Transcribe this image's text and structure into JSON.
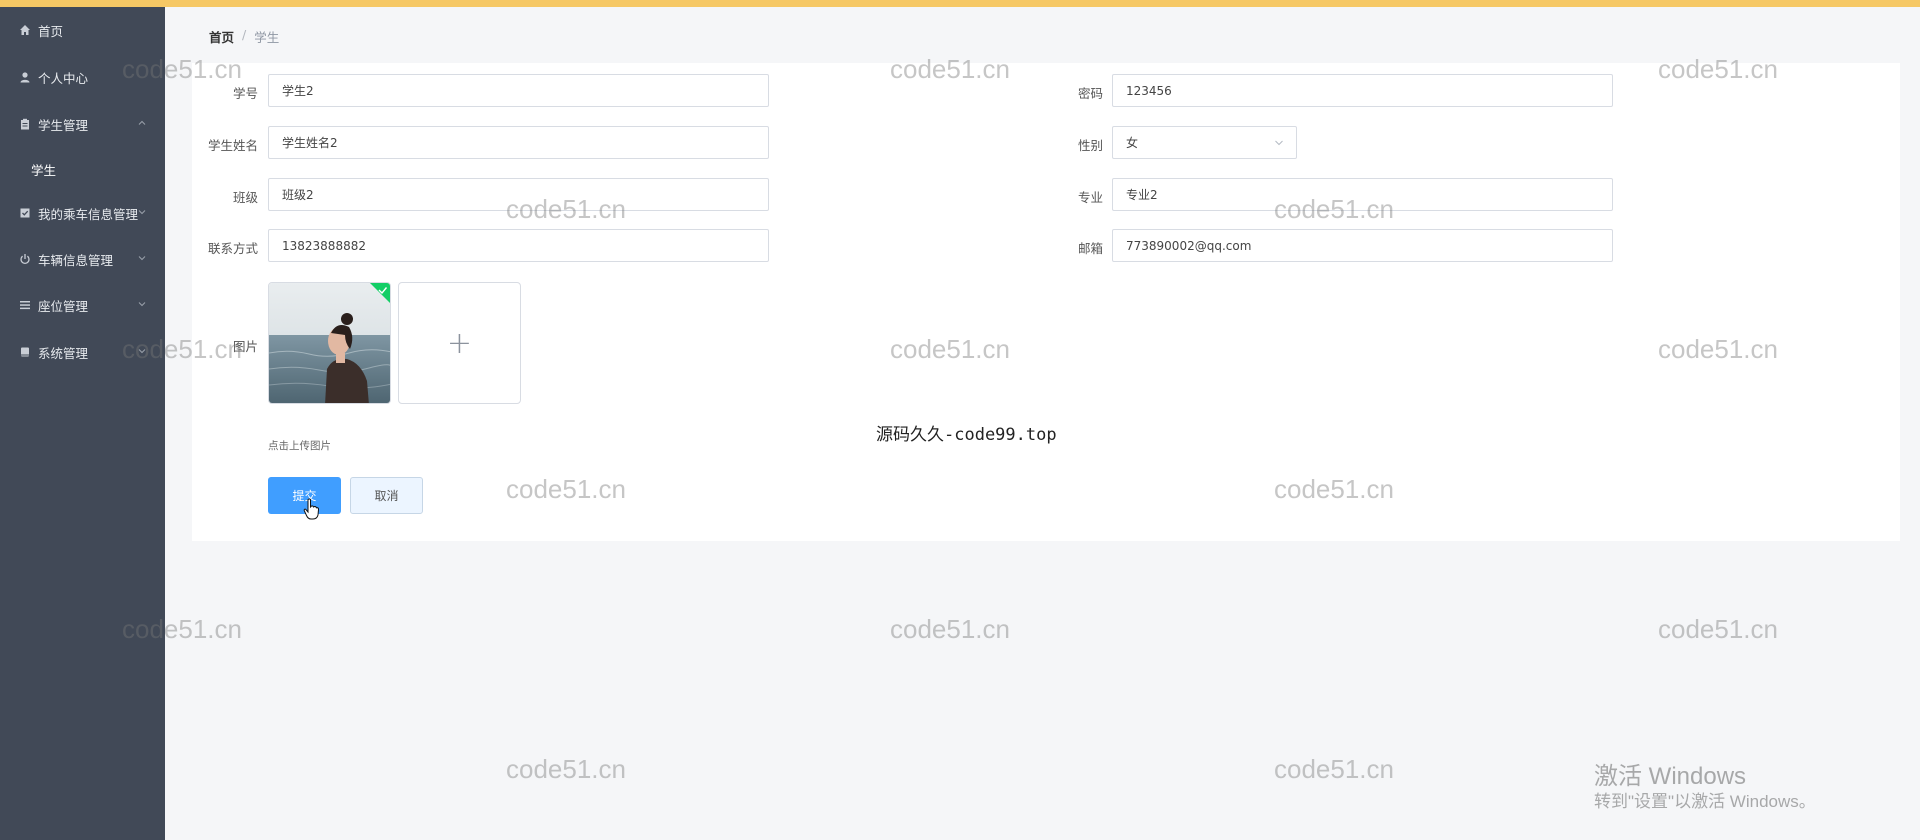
{
  "sidebar": {
    "items": [
      {
        "label": "首页",
        "icon": "home-icon"
      },
      {
        "label": "个人中心",
        "icon": "user-icon"
      },
      {
        "label": "学生管理",
        "icon": "clipboard-icon",
        "expanded": true
      },
      {
        "label": "学生"
      },
      {
        "label": "我的乘车信息管理",
        "icon": "checkbox-icon"
      },
      {
        "label": "车辆信息管理",
        "icon": "power-icon"
      },
      {
        "label": "座位管理",
        "icon": "list-icon"
      },
      {
        "label": "系统管理",
        "icon": "book-icon"
      }
    ]
  },
  "breadcrumb": {
    "home": "首页",
    "separator": "/",
    "current": "学生"
  },
  "form": {
    "student_no": {
      "label": "学号",
      "value": "学生2"
    },
    "password": {
      "label": "密码",
      "value": "123456"
    },
    "name": {
      "label": "学生姓名",
      "value": "学生姓名2"
    },
    "gender": {
      "label": "性别",
      "value": "女"
    },
    "class": {
      "label": "班级",
      "value": "班级2"
    },
    "major": {
      "label": "专业",
      "value": "专业2"
    },
    "phone": {
      "label": "联系方式",
      "value": "13823888882"
    },
    "email": {
      "label": "邮箱",
      "value": "773890002@qq.com"
    },
    "image": {
      "label": "图片",
      "tip": "点击上传图片",
      "add_symbol": "+"
    },
    "submit_label": "提交",
    "cancel_label": "取消"
  },
  "overlay_text": "源码久久-code99.top",
  "watermark": "code51.cn",
  "windows_activation": {
    "title": "激活 Windows",
    "subtitle": "转到\"设置\"以激活 Windows。"
  },
  "colors": {
    "sidebar": "#414957",
    "primary": "#409eff",
    "top_strip": "#f6c865",
    "success": "#13ce66"
  }
}
